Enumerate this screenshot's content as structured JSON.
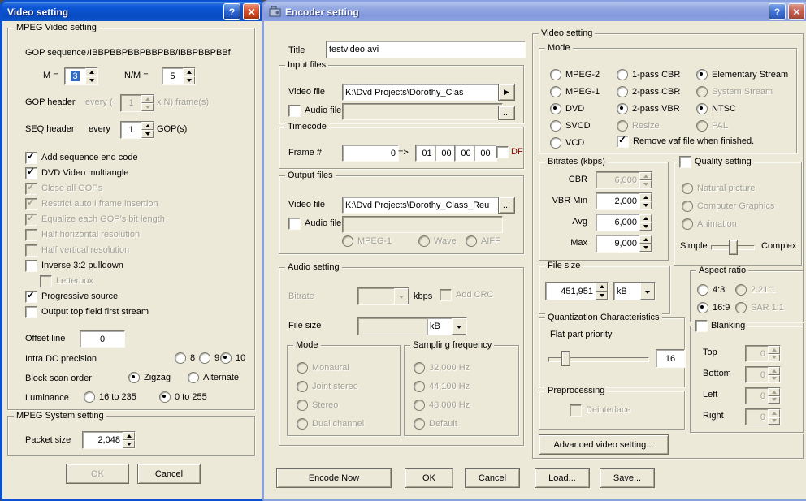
{
  "glyphs": {
    "help": "?",
    "close": "✕",
    "play": "▶",
    "browse": "..."
  },
  "video_window": {
    "title": "Video setting",
    "group1": {
      "caption": "MPEG Video setting",
      "gop_label": "GOP sequence",
      "gop_value": "/IBBPBBPBBPBBPBB/IBBPBBPBBf",
      "m_label": "M =",
      "m_value": "3",
      "nm_label": "N/M =",
      "nm_value": "5",
      "goph_label": "GOP header",
      "goph_pre": "every (",
      "goph_value": "1",
      "goph_suf": "x N) frame(s)",
      "seqh_label": "SEQ header",
      "seqh_pre": "every",
      "seqh_value": "1",
      "seqh_suf": "GOP(s)",
      "checks": [
        {
          "label": "Add sequence end code",
          "checked": true,
          "enabled": true
        },
        {
          "label": "DVD Video multiangle",
          "checked": true,
          "enabled": true
        },
        {
          "label": "Close all GOPs",
          "checked": true,
          "enabled": false
        },
        {
          "label": "Restrict auto I frame insertion",
          "checked": true,
          "enabled": false
        },
        {
          "label": "Equalize each GOP's bit length",
          "checked": true,
          "enabled": false
        },
        {
          "label": "Half horizontal resolution",
          "checked": false,
          "enabled": false
        },
        {
          "label": "Half vertical resolution",
          "checked": false,
          "enabled": false
        },
        {
          "label": "Inverse 3:2 pulldown",
          "checked": false,
          "enabled": true
        },
        {
          "label": "Letterbox",
          "checked": false,
          "enabled": false
        },
        {
          "label": "Progressive source",
          "checked": true,
          "enabled": true
        },
        {
          "label": "Output top field first stream",
          "checked": false,
          "enabled": true
        }
      ],
      "offset_label": "Offset line",
      "offset_value": "0",
      "intra_label": "Intra DC precision",
      "intra_opts": [
        {
          "label": "8",
          "selected": false
        },
        {
          "label": "9",
          "selected": false
        },
        {
          "label": "10",
          "selected": true
        }
      ],
      "scan_label": "Block scan order",
      "scan_opts": [
        {
          "label": "Zigzag",
          "selected": true
        },
        {
          "label": "Alternate",
          "selected": false
        }
      ],
      "lum_label": "Luminance",
      "lum_opts": [
        {
          "label": "16 to 235",
          "selected": false
        },
        {
          "label": "0 to 255",
          "selected": true
        }
      ]
    },
    "group2": {
      "caption": "MPEG System setting",
      "packet_label": "Packet size",
      "packet_value": "2,048"
    },
    "ok": "OK",
    "cancel": "Cancel"
  },
  "encoder_window": {
    "title": "Encoder setting",
    "title_label": "Title",
    "title_value": "testvideo.avi",
    "input_files": {
      "caption": "Input files",
      "video_label": "Video file",
      "video_value": "K:\\Dvd Projects\\Dorothy_Clas",
      "audio_label": "Audio file",
      "audio_value": ""
    },
    "timecode": {
      "caption": "Timecode",
      "frame_label": "Frame #",
      "frame_value": "0",
      "arrow": "=>",
      "fields": [
        "01",
        "00",
        "00",
        "00"
      ],
      "df_label": "DF"
    },
    "output_files": {
      "caption": "Output files",
      "video_label": "Video file",
      "video_value": "K:\\Dvd Projects\\Dorothy_Class_Reu",
      "audio_label": "Audio file",
      "audio_value": "",
      "formats": [
        {
          "label": "MPEG-1",
          "selected": false
        },
        {
          "label": "Wave",
          "selected": false
        },
        {
          "label": "AIFF",
          "selected": false
        }
      ]
    },
    "audio": {
      "caption": "Audio setting",
      "bitrate_label": "Bitrate",
      "bitrate_value": "",
      "bitrate_unit": "kbps",
      "addcrc_label": "Add CRC",
      "filesize_label": "File size",
      "filesize_value": "",
      "filesize_unit": "kB",
      "mode": {
        "caption": "Mode",
        "opts": [
          "Monaural",
          "Joint stereo",
          "Stereo",
          "Dual channel"
        ]
      },
      "sampling": {
        "caption": "Sampling frequency",
        "opts": [
          "32,000 Hz",
          "44,100 Hz",
          "48,000 Hz",
          "Default"
        ]
      }
    },
    "video": {
      "caption": "Video setting",
      "mode": {
        "caption": "Mode",
        "formats": [
          {
            "label": "MPEG-2",
            "selected": false
          },
          {
            "label": "MPEG-1",
            "selected": false
          },
          {
            "label": "DVD",
            "selected": true
          },
          {
            "label": "SVCD",
            "selected": false
          },
          {
            "label": "VCD",
            "selected": false
          }
        ],
        "passes": [
          {
            "label": "1-pass CBR",
            "selected": false,
            "enabled": true
          },
          {
            "label": "2-pass CBR",
            "selected": false,
            "enabled": true
          },
          {
            "label": "2-pass VBR",
            "selected": true,
            "enabled": true
          },
          {
            "label": "Resize",
            "selected": false,
            "enabled": false
          }
        ],
        "streams": [
          {
            "label": "Elementary Stream",
            "selected": true,
            "enabled": true
          },
          {
            "label": "System Stream",
            "selected": false,
            "enabled": false
          },
          {
            "label": "NTSC",
            "selected": true,
            "enabled": true
          },
          {
            "label": "PAL",
            "selected": false,
            "enabled": false
          }
        ],
        "remove_vaf_label": "Remove vaf file when finished.",
        "remove_vaf_checked": true
      },
      "bitrates": {
        "caption": "Bitrates (kbps)",
        "rows": [
          {
            "label": "CBR",
            "value": "6,000",
            "enabled": false
          },
          {
            "label": "VBR Min",
            "value": "2,000",
            "enabled": true
          },
          {
            "label": "Avg",
            "value": "6,000",
            "enabled": true
          },
          {
            "label": "Max",
            "value": "9,000",
            "enabled": true
          }
        ]
      },
      "quality": {
        "caption": "Quality setting",
        "checked": false,
        "opts": [
          "Natural picture",
          "Computer Graphics",
          "Animation"
        ],
        "simple": "Simple",
        "complex": "Complex"
      },
      "filesize": {
        "caption": "File size",
        "value": "451,951",
        "unit": "kB"
      },
      "aspect": {
        "caption": "Aspect ratio",
        "opts": [
          {
            "label": "4:3",
            "selected": false,
            "enabled": true
          },
          {
            "label": "2.21:1",
            "selected": false,
            "enabled": false
          },
          {
            "label": "16:9",
            "selected": true,
            "enabled": true
          },
          {
            "label": "SAR 1:1",
            "selected": false,
            "enabled": false
          }
        ]
      },
      "quant": {
        "caption": "Quantization Characteristics",
        "slider_label": "Flat part priority",
        "value": "16"
      },
      "preproc": {
        "caption": "Preprocessing",
        "deinterlace_label": "Deinterlace",
        "deinterlace_checked": false
      },
      "blanking": {
        "caption": "Blanking",
        "checked": false,
        "rows": [
          {
            "label": "Top",
            "value": "0"
          },
          {
            "label": "Bottom",
            "value": "0"
          },
          {
            "label": "Left",
            "value": "0"
          },
          {
            "label": "Right",
            "value": "0"
          }
        ]
      },
      "advanced": "Advanced video setting..."
    },
    "buttons": {
      "encode": "Encode Now",
      "ok": "OK",
      "cancel": "Cancel",
      "load": "Load...",
      "save": "Save..."
    }
  }
}
